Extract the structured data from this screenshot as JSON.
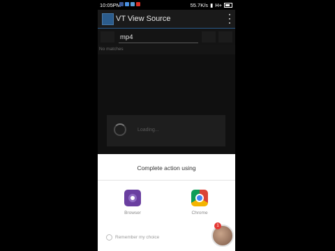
{
  "status_bar": {
    "time": "10:05PM",
    "network_speed": "55.7K/s",
    "network_type": "H+",
    "notification_icons": [
      "facebook-icon",
      "messenger-icon",
      "app-icon",
      "gmail-icon"
    ],
    "notification_colors": [
      "#3b5998",
      "#4a90e2",
      "#5aa0d8",
      "#d93025"
    ]
  },
  "action_bar": {
    "title": "VT View Source"
  },
  "search": {
    "value": "mp4",
    "no_matches": "No matches"
  },
  "loading": {
    "text": "Loading..."
  },
  "chooser": {
    "title": "Complete action using",
    "options": [
      {
        "label": "Browser",
        "icon": "browser-icon"
      },
      {
        "label": "Chrome",
        "icon": "chrome-icon"
      }
    ],
    "remember_label": "Remember my choice"
  },
  "bubble": {
    "badge": "1"
  }
}
